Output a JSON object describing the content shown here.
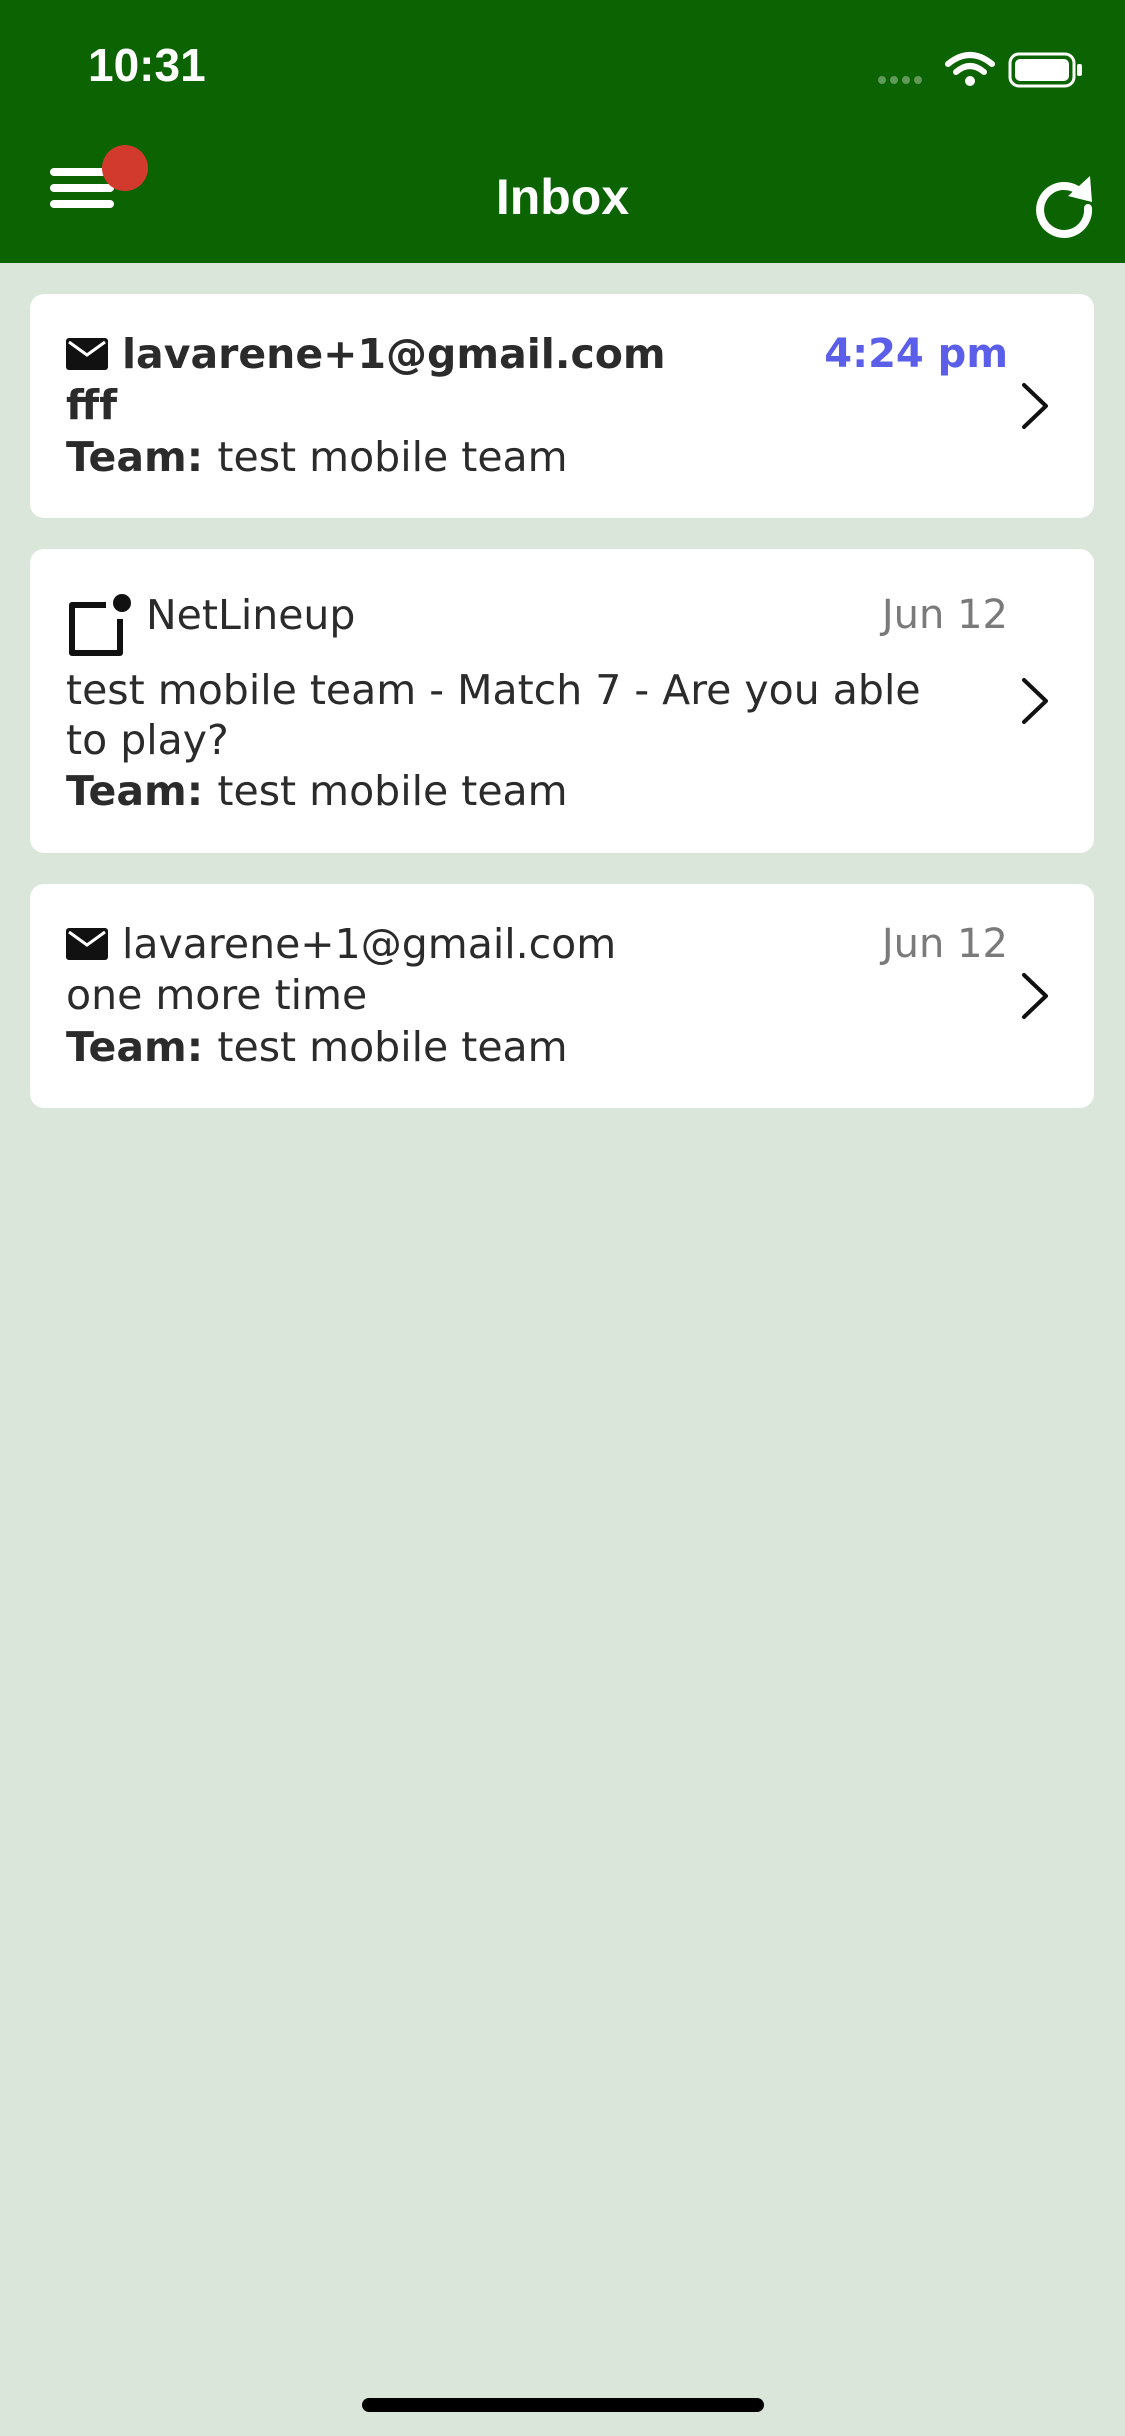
{
  "status_bar": {
    "time": "10:31"
  },
  "header": {
    "title": "Inbox",
    "accent_color": "#0b6302",
    "badge_color": "#d23a2e"
  },
  "messages": [
    {
      "icon": "mail-icon",
      "sender": "lavarene+1@gmail.com",
      "date": "4:24 pm",
      "subject": "fff",
      "team_label": "Team:",
      "team": "test mobile team",
      "unread": true
    },
    {
      "icon": "notification-icon",
      "sender": "NetLineup",
      "date": "Jun 12",
      "subject": "test mobile team - Match 7 - Are you able to play?",
      "team_label": "Team:",
      "team": "test mobile team",
      "unread": false
    },
    {
      "icon": "mail-icon",
      "sender": "lavarene+1@gmail.com",
      "date": "Jun 12",
      "subject": "one more time",
      "team_label": "Team:",
      "team": "test mobile team",
      "unread": false
    }
  ]
}
